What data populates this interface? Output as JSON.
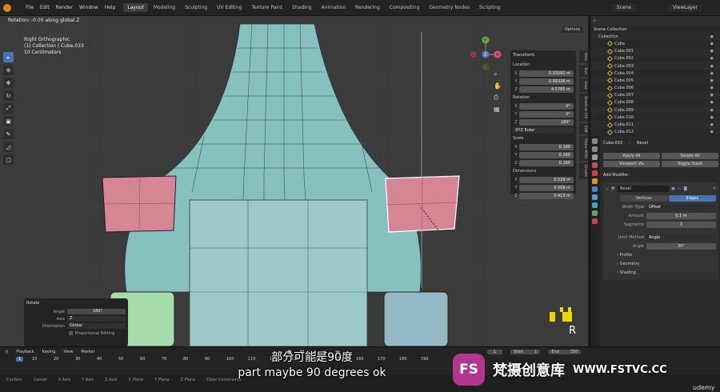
{
  "topbar": {
    "menus": [
      "File",
      "Edit",
      "Render",
      "Window",
      "Help"
    ],
    "workspaces": [
      "Layout",
      "Modeling",
      "Sculpting",
      "UV Editing",
      "Texture Paint",
      "Shading",
      "Animation",
      "Rendering",
      "Compositing",
      "Geometry Nodes",
      "Scripting"
    ],
    "active_workspace": "Layout",
    "scene": "Scene",
    "view_layer": "ViewLayer"
  },
  "viewport": {
    "header_text": "Rotation: -0.00 along global Z",
    "overlay_lines": [
      "Right Orthographic",
      "(1) Collection | Cube.033",
      "10 Centimeters"
    ],
    "options_label": "Options",
    "axis_x": "X",
    "axis_y": "Y",
    "axis_z": "Z",
    "key_hint": "R"
  },
  "npanel": {
    "title": "Transform",
    "location_label": "Location",
    "location": [
      {
        "axis": "X",
        "value": "0.93591 m"
      },
      {
        "axis": "Y",
        "value": "0.99326 m"
      },
      {
        "axis": "Z",
        "value": "4.5785 m"
      }
    ],
    "rotation_label": "Rotation",
    "rotation": [
      {
        "axis": "X",
        "value": "0°"
      },
      {
        "axis": "Y",
        "value": "0°"
      },
      {
        "axis": "Z",
        "value": "180°"
      }
    ],
    "rotation_mode": "XYZ Euler",
    "scale_label": "Scale",
    "scale": [
      {
        "axis": "X",
        "value": "0.160"
      },
      {
        "axis": "Y",
        "value": "0.160"
      },
      {
        "axis": "Z",
        "value": "0.160"
      }
    ],
    "dimensions_label": "Dimensions",
    "dimensions": [
      {
        "axis": "X",
        "value": "0.529 m"
      },
      {
        "axis": "Y",
        "value": "0.509 m"
      },
      {
        "axis": "Z",
        "value": "0.413 m"
      }
    ],
    "tabs": [
      "Item",
      "Tool",
      "View",
      "Shortcut VUr",
      "Edit",
      "Plane HDRI",
      "Create"
    ]
  },
  "redo_panel": {
    "title": "Rotate",
    "rows": [
      {
        "label": "Angle",
        "value": "180°"
      },
      {
        "label": "Axis",
        "value": "Z"
      },
      {
        "label": "Orientation",
        "value": "Global"
      }
    ],
    "checkbox": "Proportional Editing"
  },
  "outliner": {
    "root": "Scene Collection",
    "collection": "Collection",
    "items": [
      "Cube",
      "Cube.001",
      "Cube.002",
      "Cube.003",
      "Cube.004",
      "Cube.005",
      "Cube.006",
      "Cube.007",
      "Cube.008",
      "Cube.009",
      "Cube.010",
      "Cube.011",
      "Cube.012"
    ]
  },
  "properties": {
    "object_name": "Cube.033",
    "modifier_type": "Bevel",
    "apply_all": "Apply All",
    "delete_all": "Delete All",
    "viewport_vis": "Viewport Vis",
    "toggle_stack": "Toggle Stack",
    "add_modifier": "Add Modifier",
    "modifier_name": "Bevel",
    "tab_vertices": "Vertices",
    "tab_edges": "Edges",
    "width_type_label": "Width Type",
    "width_type": "Offset",
    "amount_label": "Amount",
    "amount": "0.1 m",
    "segments_label": "Segments",
    "segments": "1",
    "limit_method_label": "Limit Method",
    "limit_method": "Angle",
    "angle_label": "Angle",
    "angle": "30°",
    "subpanels": [
      "Profile",
      "Geometry",
      "Shading"
    ]
  },
  "timeline": {
    "menus": [
      "Playback",
      "Keying",
      "View",
      "Marker"
    ],
    "current_frame": "1",
    "start_label": "Start",
    "start": "1",
    "end_label": "End",
    "end": "250",
    "ticks": [
      "10",
      "20",
      "30",
      "40",
      "50",
      "60",
      "70",
      "80",
      "90",
      "100",
      "110",
      "120",
      "130",
      "140",
      "150",
      "160",
      "170",
      "180",
      "190"
    ]
  },
  "statusbar": {
    "items": [
      "Confirm",
      "Cancel",
      "X Axis",
      "Y Axis",
      "Z Axis",
      "X Plane",
      "Y Plane",
      "Z Plane",
      "Clear Constraints"
    ]
  },
  "subtitles": {
    "chinese": "部分可能是90度",
    "english": "part maybe 90 degrees ok"
  },
  "watermark": {
    "logo": "FS",
    "brand": "梵摄创意库",
    "url": "WWW.FSTVC.CC",
    "corner": "udemy"
  }
}
